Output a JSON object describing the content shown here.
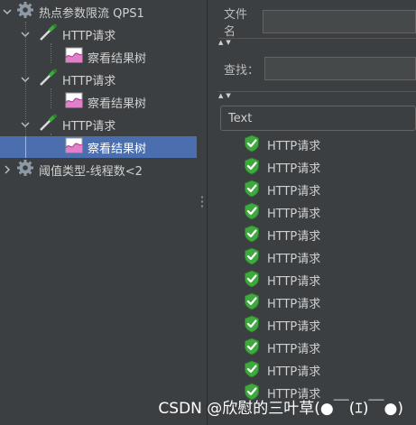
{
  "tree": {
    "items": [
      {
        "label": "热点参数限流 QPS1",
        "icon": "thread-group-gear-icon",
        "expanded": true
      },
      {
        "label": "HTTP请求",
        "icon": "http-sampler-pipette-icon",
        "expanded": true
      },
      {
        "label": "察看结果树",
        "icon": "view-results-tree-chart-icon"
      },
      {
        "label": "HTTP请求",
        "icon": "http-sampler-pipette-icon",
        "expanded": true
      },
      {
        "label": "察看结果树",
        "icon": "view-results-tree-chart-icon"
      },
      {
        "label": "HTTP请求",
        "icon": "http-sampler-pipette-icon",
        "expanded": true
      },
      {
        "label": "察看结果树",
        "icon": "view-results-tree-chart-icon",
        "selected": true
      },
      {
        "label": "阈值类型-线程数<2",
        "icon": "thread-group-gear-icon",
        "expanded": false
      }
    ]
  },
  "panel": {
    "filename_label": "文件名",
    "filename_value": "",
    "search_label": "查找：",
    "search_value": "",
    "renderer_selected": "Text"
  },
  "results": {
    "icon": "success-shield-check-icon",
    "items": [
      "HTTP请求",
      "HTTP请求",
      "HTTP请求",
      "HTTP请求",
      "HTTP请求",
      "HTTP请求",
      "HTTP请求",
      "HTTP请求",
      "HTTP请求",
      "HTTP请求",
      "HTTP请求",
      "HTTP请求"
    ]
  },
  "watermark": "CSDN @欣慰的三叶草(●￣(ｴ)￣●)",
  "colors": {
    "background": "#3c3f41",
    "selection": "#4b6eaf",
    "success_green": "#3fa83f"
  }
}
